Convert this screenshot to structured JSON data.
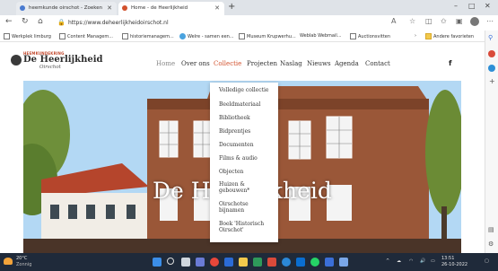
{
  "browser": {
    "tabs": [
      {
        "label": "heemkunde oirschot - Zoeken"
      },
      {
        "label": "Home - de Heerlijkheid"
      }
    ],
    "new_tab": "+",
    "window_controls": {
      "minimize": "–",
      "maximize": "□",
      "close": "✕"
    },
    "url": "https://www.deheerlijkheidoirschot.nl",
    "bookmarks": [
      {
        "label": "Werkplek limburg"
      },
      {
        "label": "Content Managem..."
      },
      {
        "label": "historiemanagem..."
      },
      {
        "label": "Welre - samen een..."
      },
      {
        "label": "Museum Krupwerhu..."
      },
      {
        "label": "Weblab Webmail..."
      },
      {
        "label": "Auctionsvitten"
      }
    ],
    "other_favorites": "Andere favorieten"
  },
  "site": {
    "logo": {
      "tagline": "HEEMKUNDEKRING",
      "title": "De Heerlijkheid",
      "subtitle": "Oirschot"
    },
    "nav": [
      {
        "label": "Home"
      },
      {
        "label": "Over ons"
      },
      {
        "label": "Collectie"
      },
      {
        "label": "Projecten"
      },
      {
        "label": "Naslag"
      },
      {
        "label": "Nieuws"
      },
      {
        "label": "Agenda"
      },
      {
        "label": "Contact"
      }
    ],
    "facebook": "f",
    "hero_title": "De Heerlijkheid",
    "dropdown": [
      {
        "label": "Volledige collectie"
      },
      {
        "label": "Beeldmateriaal"
      },
      {
        "label": "Bibliotheek"
      },
      {
        "label": "Bidprentjes"
      },
      {
        "label": "Documenten"
      },
      {
        "label": "Films & audio"
      },
      {
        "label": "Objecten"
      },
      {
        "label": "Huizen &"
      },
      {
        "label": "gebouwen*"
      },
      {
        "label": "Oirschotse"
      },
      {
        "label": "bijnamen"
      },
      {
        "label": "Boek 'Historisch"
      },
      {
        "label": "Oirschot'"
      }
    ]
  },
  "taskbar": {
    "weather_temp": "20°C",
    "weather_desc": "Zonnig",
    "time": "13:51",
    "date": "26-10-2022"
  },
  "colors": {
    "accent": "#d2512d",
    "taskbar": "#1f2a3a"
  }
}
